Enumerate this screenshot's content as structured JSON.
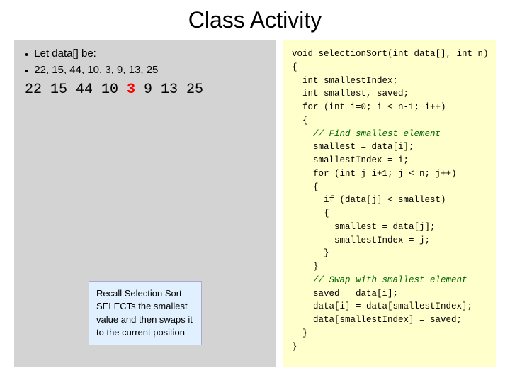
{
  "page": {
    "title": "Class Activity"
  },
  "left": {
    "bullet1": "Let data[] be:",
    "bullet2": "22, 15, 44, 10, 3, 9, 13, 25",
    "array_prefix": "22  15  44  10  ",
    "array_highlight": "3",
    "array_suffix": "   9   13  25"
  },
  "recall": {
    "text": "Recall Selection Sort SELECTs the smallest value and then swaps it to the current position"
  },
  "code": {
    "lines": [
      "void selectionSort(int data[], int n)",
      "{",
      "  int smallestIndex;",
      "  int smallest, saved;",
      "  for (int i=0; i < n-1; i++)",
      "  {",
      "    // Find smallest element",
      "    smallest = data[i];",
      "    smallestIndex = i;",
      "    for (int j=i+1; j < n; j++)",
      "    {",
      "      if (data[j] < smallest)",
      "      {",
      "        smallest = data[j];",
      "        smallestIndex = j;",
      "      }",
      "    }",
      "",
      "    // Swap with smallest element",
      "    saved = data[i];",
      "    data[i] = data[smallestIndex];",
      "    data[smallestIndex] = saved;",
      "  }",
      "}"
    ],
    "comment_indices": [
      6,
      18
    ]
  }
}
